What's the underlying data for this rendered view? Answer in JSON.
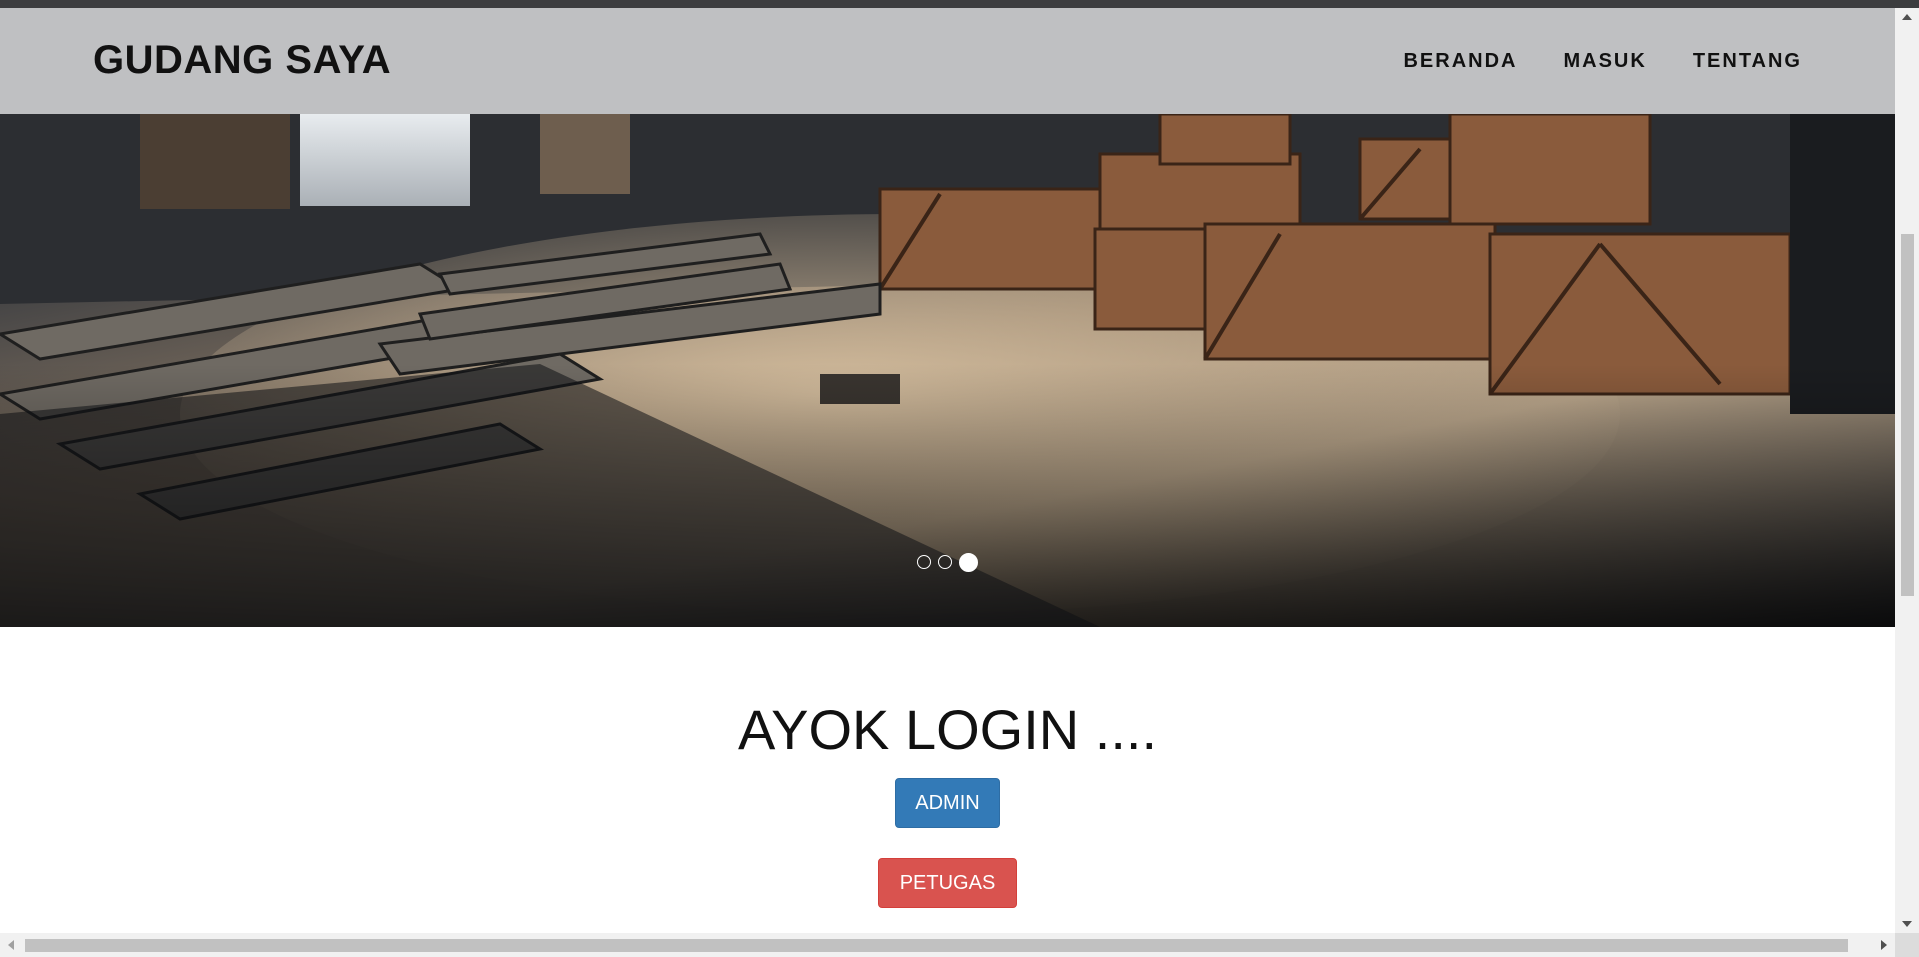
{
  "brand": {
    "title": "GUDANG SAYA"
  },
  "nav": {
    "items": [
      {
        "label": "BERANDA"
      },
      {
        "label": "MASUK"
      },
      {
        "label": "TENTANG"
      }
    ]
  },
  "carousel": {
    "slide_count": 3,
    "active_index": 2,
    "image_description": "warehouse-with-wooden-crates-and-pallets"
  },
  "login": {
    "heading": "AYOK LOGIN ....",
    "admin_label": "ADMIN",
    "petugas_label": "PETUGAS"
  },
  "colors": {
    "navbar_bg": "#bfc0c2",
    "admin_button": "#337ab7",
    "petugas_button": "#d9534f"
  }
}
